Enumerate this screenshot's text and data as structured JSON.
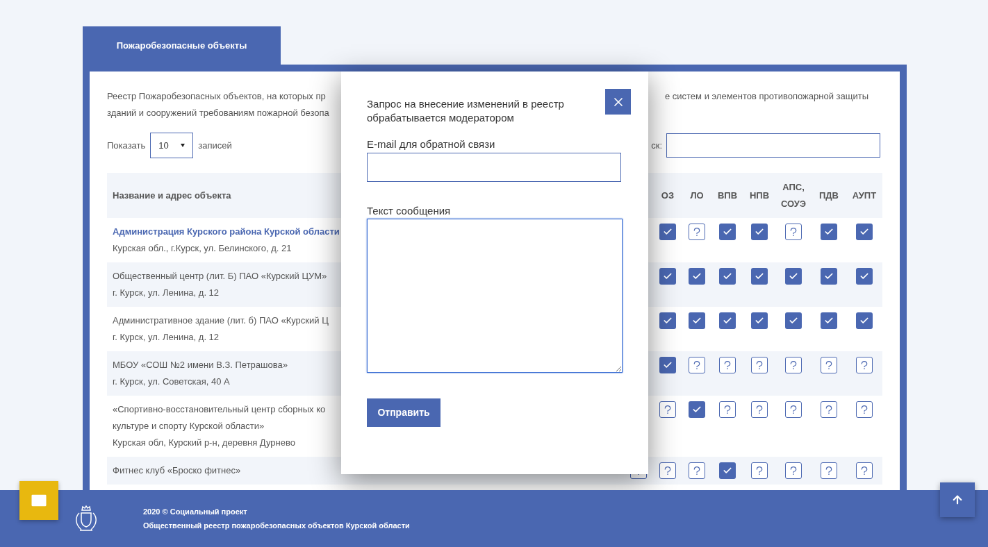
{
  "tab": {
    "label": "Пожаробезопасные объекты",
    "selected": true
  },
  "description_left": [
    "Реестр Пожаробезопасных объектов, на которых пр",
    "зданий и сооружений требованиям пожарной безопа"
  ],
  "description_right": "е систем и элементов противопожарной защиты",
  "length_control": {
    "prefix": "Показать",
    "value": "10",
    "suffix": "записей"
  },
  "search": {
    "label": "ск:"
  },
  "table": {
    "name_column": "Название и адрес объекта",
    "mark_columns": [
      "ОЗ",
      "ЛО",
      "ВПВ",
      "НПВ",
      "АПС, СОУЭ",
      "ПДВ",
      "АУПТ"
    ],
    "rows": [
      {
        "kind": "link",
        "name_lines": [
          "Администрация Курского района Курской области"
        ],
        "address": "Курская обл., г.Курск, ул. Белинского, д. 21",
        "marks": [
          {
            "kind": "check"
          },
          {
            "kind": "question"
          },
          {
            "kind": "check"
          },
          {
            "kind": "check"
          },
          {
            "kind": "question"
          },
          {
            "kind": "check"
          },
          {
            "kind": "check"
          }
        ]
      },
      {
        "kind": "plain",
        "name_lines": [
          "Общественный центр (лит. Б) ПАО «Курский ЦУМ»"
        ],
        "address": "г. Курск, ул. Ленина, д. 12",
        "marks": [
          {
            "kind": "check"
          },
          {
            "kind": "check"
          },
          {
            "kind": "check"
          },
          {
            "kind": "check"
          },
          {
            "kind": "check"
          },
          {
            "kind": "check"
          },
          {
            "kind": "check"
          }
        ]
      },
      {
        "kind": "plain",
        "name_lines": [
          "Административное здание (лит. б) ПАО «Курский Ц"
        ],
        "address": "г. Курск, ул. Ленина, д. 12",
        "marks": [
          {
            "kind": "check"
          },
          {
            "kind": "check"
          },
          {
            "kind": "check"
          },
          {
            "kind": "check"
          },
          {
            "kind": "check"
          },
          {
            "kind": "check"
          },
          {
            "kind": "check"
          }
        ]
      },
      {
        "kind": "plain",
        "name_lines": [
          "МБОУ «СОШ №2 имени В.З. Петрашова»"
        ],
        "address": "г. Курск, ул. Советская, 40 А",
        "marks": [
          {
            "kind": "check"
          },
          {
            "kind": "question"
          },
          {
            "kind": "question"
          },
          {
            "kind": "question"
          },
          {
            "kind": "question"
          },
          {
            "kind": "question"
          },
          {
            "kind": "question"
          }
        ]
      },
      {
        "kind": "plain",
        "name_lines": [
          "«Спортивно-восстановительный центр сборных ко",
          "культуре и спорту Курской области»"
        ],
        "address": "Курская обл, Курский р-н, деревня Дурнево",
        "marks": [
          {
            "kind": "question"
          },
          {
            "kind": "check"
          },
          {
            "kind": "question"
          },
          {
            "kind": "question"
          },
          {
            "kind": "question"
          },
          {
            "kind": "question"
          },
          {
            "kind": "question"
          }
        ]
      },
      {
        "kind": "plain",
        "name_lines": [
          "Фитнес клуб «Броско фитнес»"
        ],
        "hidden_column_mark": {
          "kind": "question"
        },
        "marks": [
          {
            "kind": "question"
          },
          {
            "kind": "question"
          },
          {
            "kind": "check"
          },
          {
            "kind": "question"
          },
          {
            "kind": "question"
          },
          {
            "kind": "question"
          },
          {
            "kind": "question"
          }
        ]
      }
    ]
  },
  "modal": {
    "title": "Запрос на внесение изменений в реестр обрабатывается модератором",
    "email_label": "E-mail для обратной связи",
    "message_label": "Текст сообщения",
    "message_focused": true,
    "submit": "Отправить"
  },
  "footer": {
    "lines": [
      "2020 © Социальный проект",
      "Общественный реестр пожаробезопасных объектов Курской области"
    ]
  }
}
